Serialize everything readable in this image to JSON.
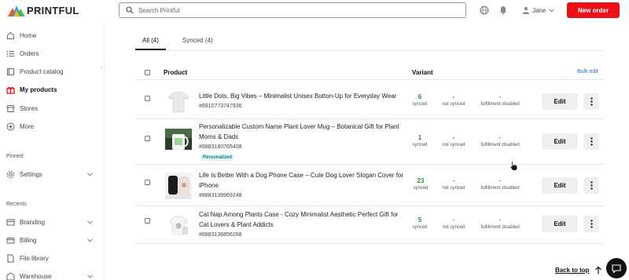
{
  "brand": {
    "name": "PRINTFUL",
    "accent": "#e8111a"
  },
  "header": {
    "search_placeholder": "Search Printful",
    "user_name": "Jane",
    "new_order_label": "New order",
    "icons": [
      "globe-icon",
      "bell-icon",
      "user-icon",
      "chevron-down-icon"
    ]
  },
  "sidebar": {
    "items": [
      {
        "label": "Home",
        "icon": "home-icon"
      },
      {
        "label": "Orders",
        "icon": "list-icon"
      },
      {
        "label": "Product catalog",
        "icon": "book-icon"
      },
      {
        "label": "My products",
        "icon": "gift-icon"
      },
      {
        "label": "Stores",
        "icon": "store-icon"
      },
      {
        "label": "More",
        "icon": "plus-circle-icon"
      }
    ],
    "pinned_label": "Pinned",
    "pinned_items": [
      {
        "label": "Settings",
        "icon": "gear-icon"
      }
    ],
    "recents_label": "Recents",
    "recent_items": [
      {
        "label": "Branding",
        "icon": "branding-icon"
      },
      {
        "label": "Billing",
        "icon": "card-icon"
      },
      {
        "label": "File library",
        "icon": "file-icon"
      },
      {
        "label": "Warehouse",
        "icon": "warehouse-icon"
      }
    ]
  },
  "tabs": [
    {
      "label": "All",
      "count": "(4)"
    },
    {
      "label": "Synced",
      "count": "(4)"
    }
  ],
  "table": {
    "col_product": "Product",
    "col_variant": "Variant",
    "bulk_edit": "Bulk edit",
    "edit_label": "Edit",
    "rows": [
      {
        "title": "Little Dots, Big Vibes – Minimalist Unisex Button-Up for Everyday Wear",
        "sku": "#8910773747936",
        "badge": "",
        "synced": "6",
        "synced_label": "synced",
        "not_synced": "-",
        "not_synced_label": "not synced",
        "fulfillment": "-",
        "fulfillment_label": "fulfillment disabled"
      },
      {
        "title": "Personalizable Custom Name Plant Lover Mug – Botanical Gift for Plant Moms & Dads",
        "sku": "#8883180765408",
        "badge": "Personalized",
        "synced": "1",
        "synced_label": "synced",
        "not_synced": "-",
        "not_synced_label": "not synced",
        "fulfillment": "-",
        "fulfillment_label": "fulfillment disabled"
      },
      {
        "title": "Life Is Better With a Dog Phone Case – Cute Dog Lover Slogan Cover for iPhone",
        "sku": "#8883139969248",
        "badge": "",
        "synced": "23",
        "synced_label": "synced",
        "not_synced": "-",
        "not_synced_label": "not synced",
        "fulfillment": "-",
        "fulfillment_label": "fulfillment disabled"
      },
      {
        "title": "Cat Nap Among Plants Case - Cozy Minimalist Aesthetic Perfect Gift for Cat Lovers & Plant Addicts",
        "sku": "#8883136856288",
        "badge": "",
        "synced": "5",
        "synced_label": "synced",
        "not_synced": "-",
        "not_synced_label": "not synced",
        "fulfillment": "-",
        "fulfillment_label": "fulfillment disabled"
      }
    ]
  },
  "footer": {
    "back_to_top": "Back to top"
  },
  "colors": {
    "synced": "#1e8e2e",
    "not_synced": "#e0252a",
    "link": "#2469c9"
  }
}
